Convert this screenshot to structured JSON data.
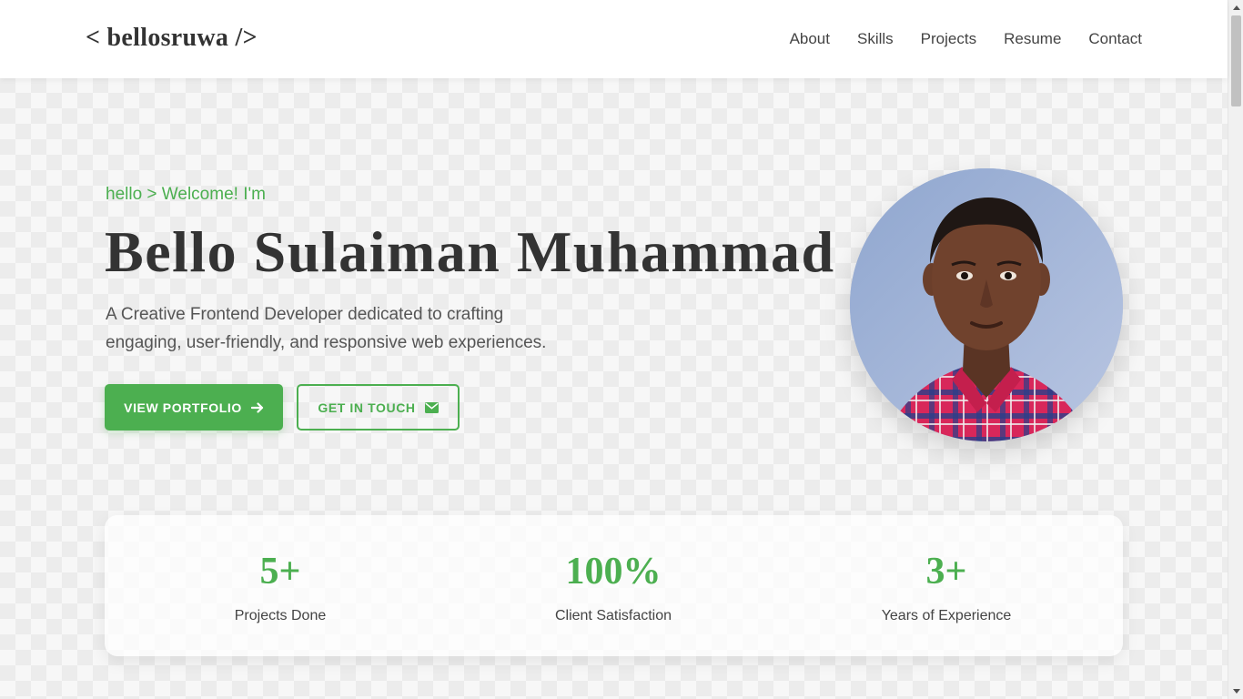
{
  "header": {
    "logo": "< bellosruwa />",
    "nav": [
      "About",
      "Skills",
      "Projects",
      "Resume",
      "Contact"
    ]
  },
  "hero": {
    "greeting": "hello > Welcome! I'm",
    "name": "Bello Sulaiman Muhammad",
    "tagline": "A Creative Frontend Developer dedicated to crafting engaging, user-friendly, and responsive web experiences.",
    "primary_button": {
      "label": "VIEW PORTFOLIO",
      "icon": "arrow-right-icon"
    },
    "secondary_button": {
      "label": "GET IN TOUCH",
      "icon": "envelope-icon"
    },
    "photo_icon": "profile-photo"
  },
  "stats": [
    {
      "value": "5+",
      "label": "Projects Done"
    },
    {
      "value": "100%",
      "label": "Client Satisfaction"
    },
    {
      "value": "3+",
      "label": "Years of Experience"
    }
  ],
  "colors": {
    "accent": "#4caf50",
    "text": "#333333",
    "header_bg": "#ffffff",
    "page_bg": "#f7f7f7"
  }
}
